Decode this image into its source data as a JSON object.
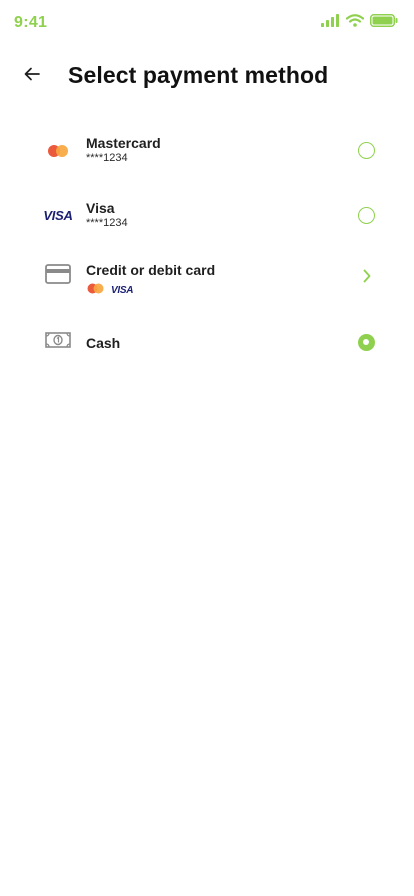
{
  "status_bar": {
    "time": "9:41",
    "icons": [
      "cellular-signal-icon",
      "wifi-icon",
      "battery-icon"
    ],
    "accent_color": "#8fd14f"
  },
  "header": {
    "back_icon": "arrow-left-icon",
    "title": "Select payment method"
  },
  "payment_methods": [
    {
      "name": "Mastercard",
      "detail": "****1234",
      "icon": "mastercard-logo-icon",
      "control": "radio",
      "selected": false
    },
    {
      "name": "Visa",
      "detail": "****1234",
      "icon": "visa-logo-icon",
      "icon_text": "VISA",
      "control": "radio",
      "selected": false
    },
    {
      "name": "Credit or debit card",
      "icon": "credit-card-icon",
      "control": "chevron-right-icon",
      "accepted": [
        "mastercard-logo-icon",
        "visa-logo-icon"
      ],
      "accepted_visa_text": "VISA"
    },
    {
      "name": "Cash",
      "icon": "cash-banknote-icon",
      "control": "radio",
      "selected": true
    }
  ],
  "colors": {
    "accent": "#8fd14f",
    "title": "#111111",
    "text": "#1f1f1f",
    "icon_gray": "#8a8a8a",
    "visa_blue": "#1a1f71",
    "mastercard_red": "#eb5a3c",
    "mastercard_orange": "#f7a640"
  }
}
